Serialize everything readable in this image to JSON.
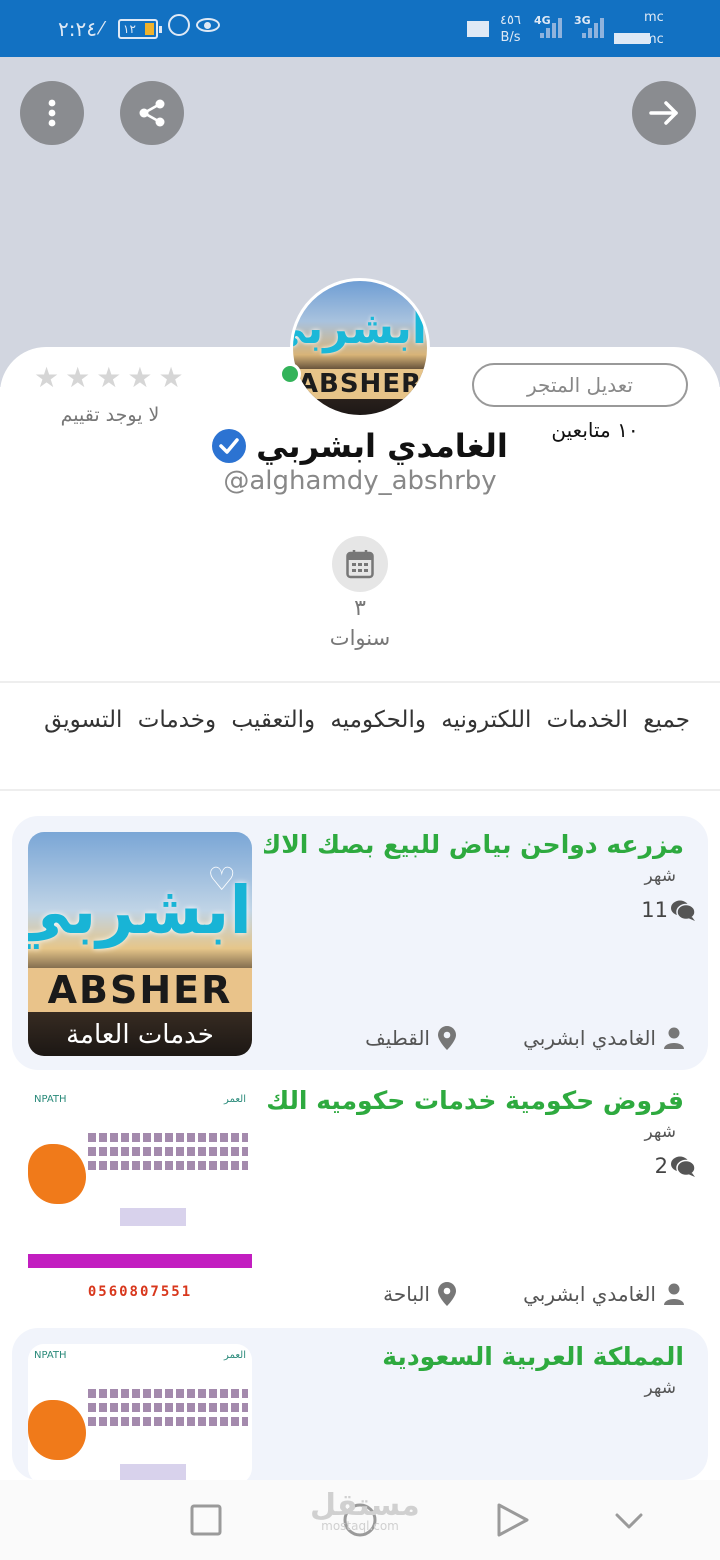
{
  "status_bar": {
    "time": "٢:٢٤",
    "battery": "١٢",
    "net_speed_value": "٤٥٦",
    "net_speed_unit": "B/s",
    "sig1_label": "4G",
    "sig2_label": "3G",
    "carrier1": "mc",
    "volte": "VoLTE",
    "carrier2": "mc"
  },
  "profile": {
    "avatar_text_ar": "ابشربي",
    "avatar_text_latin": "ABSHER",
    "rating_empty_stars": [
      "★",
      "★",
      "★",
      "★",
      "★"
    ],
    "no_rating_label": "لا يوجد تقييم",
    "edit_store_label": "تعديل المتجر",
    "followers_label": "١٠ متابعين",
    "store_name": "الغامدي ابشربي",
    "handle": "@alghamdy_abshrby",
    "years_value": "٣",
    "years_label": "سنوات"
  },
  "category_text": "جميع الخدمات اللكترونيه والحكوميه والتعقيب وخدمات التسويق",
  "listings": [
    {
      "title": "مزرعه دواحن بياض للبيع بصك الاك..",
      "time": "شهر",
      "comments": "11",
      "seller": "الغامدي ابشربي",
      "city": "القطيف",
      "image_text_ar": "ابشربي",
      "image_text_latin": "ABSHER",
      "image_text_ar2": "خدمات العامة",
      "heart_icon": "♡"
    },
    {
      "title": "قروض حكومية  خدمات حكوميه الك..",
      "time": "شهر",
      "comments": "2",
      "seller": "الغامدي ابشربي",
      "city": "الباحة",
      "flyer_phone": "0560807551"
    },
    {
      "title": "المملكة العربية السعودية",
      "time": "شهر",
      "flyer_phone": ""
    }
  ],
  "watermark": {
    "main": "مستقل",
    "sub": "mostaql.com"
  },
  "colors": {
    "status_bar": "#1271c2",
    "cover": "#d2d6e0",
    "accent_green": "#2eaa3f",
    "verified_blue": "#2c73d2",
    "online_green": "#33b35a",
    "listing_bg": "#f1f4fb"
  },
  "icons": [
    "more-vert-icon",
    "share-icon",
    "arrow-forward-icon",
    "verified-badge-icon",
    "calendar-icon",
    "comment-icon",
    "person-icon",
    "location-pin-icon",
    "heart-icon",
    "nav-recent-icon",
    "nav-home-icon",
    "nav-back-icon",
    "nav-down-icon"
  ]
}
